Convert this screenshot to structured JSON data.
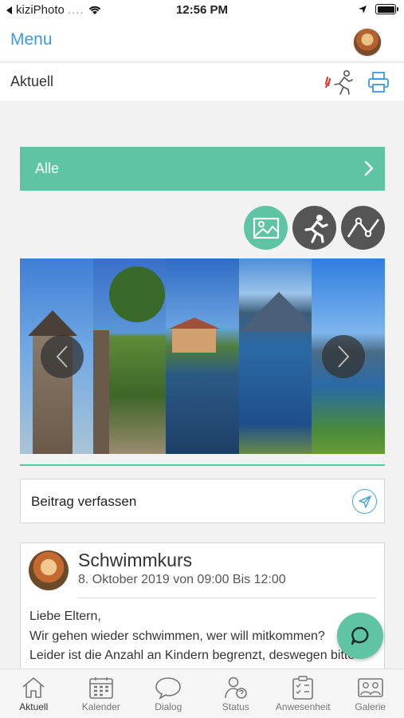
{
  "status_bar": {
    "back_app": "kiziPhoto",
    "signal": "....",
    "time": "12:56 PM"
  },
  "nav": {
    "menu_label": "Menu"
  },
  "section": {
    "title": "Aktuell"
  },
  "filter": {
    "label": "Alle"
  },
  "compose": {
    "placeholder": "Beitrag verfassen"
  },
  "post": {
    "title": "Schwimmkurs",
    "date": "8. Oktober 2019 von 09:00 Bis 12:00",
    "lines": [
      "Liebe Eltern,",
      "Wir gehen wieder schwimmen, wer will mitkommen?",
      "Leider ist die Anzahl an Kindern begrenzt,  deswegen bitte"
    ]
  },
  "tabs": [
    {
      "label": "Aktuell",
      "icon": "house-icon"
    },
    {
      "label": "Kalender",
      "icon": "calendar-icon"
    },
    {
      "label": "Dialog",
      "icon": "speech-bubble-icon"
    },
    {
      "label": "Status",
      "icon": "person-question-icon"
    },
    {
      "label": "Anwesenheit",
      "icon": "attendance-icon"
    },
    {
      "label": "Galerie",
      "icon": "gallery-icon"
    }
  ],
  "colors": {
    "accent": "#5ec4a4",
    "link": "#3a9be0",
    "dark_button": "#555555"
  }
}
